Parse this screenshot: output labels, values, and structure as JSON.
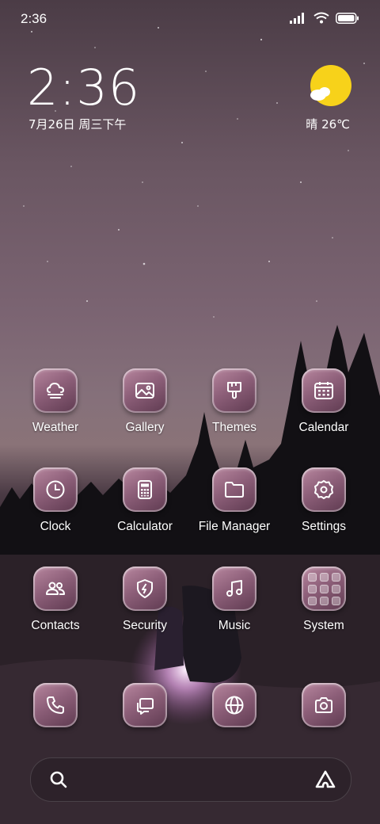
{
  "status_bar": {
    "time": "2:36"
  },
  "clock_widget": {
    "time": "2:36",
    "date": "7月26日 周三下午"
  },
  "weather_widget": {
    "text": "晴 26℃",
    "icon": "sun-cloud-icon"
  },
  "apps_row1": [
    {
      "label": "Weather",
      "icon": "weather-fog-icon"
    },
    {
      "label": "Gallery",
      "icon": "image-icon"
    },
    {
      "label": "Themes",
      "icon": "brush-icon"
    },
    {
      "label": "Calendar",
      "icon": "calendar-icon"
    }
  ],
  "apps_row2": [
    {
      "label": "Clock",
      "icon": "clock-icon"
    },
    {
      "label": "Calculator",
      "icon": "calculator-icon"
    },
    {
      "label": "File Manager",
      "icon": "folder-icon"
    },
    {
      "label": "Settings",
      "icon": "gear-icon"
    }
  ],
  "apps_row3": [
    {
      "label": "Contacts",
      "icon": "contacts-icon"
    },
    {
      "label": "Security",
      "icon": "shield-icon"
    },
    {
      "label": "Music",
      "icon": "music-note-icon"
    },
    {
      "label": "System",
      "icon": "folder-grid-icon"
    }
  ],
  "dock": [
    {
      "icon": "phone-icon"
    },
    {
      "icon": "message-icon"
    },
    {
      "icon": "globe-icon"
    },
    {
      "icon": "camera-icon"
    }
  ],
  "search_bar": {
    "left_icon": "search-icon",
    "right_icon": "assistant-icon"
  },
  "colors": {
    "icon_top": "#b8879f",
    "icon_bottom": "#5e3a50",
    "sun": "#f7d21a"
  }
}
